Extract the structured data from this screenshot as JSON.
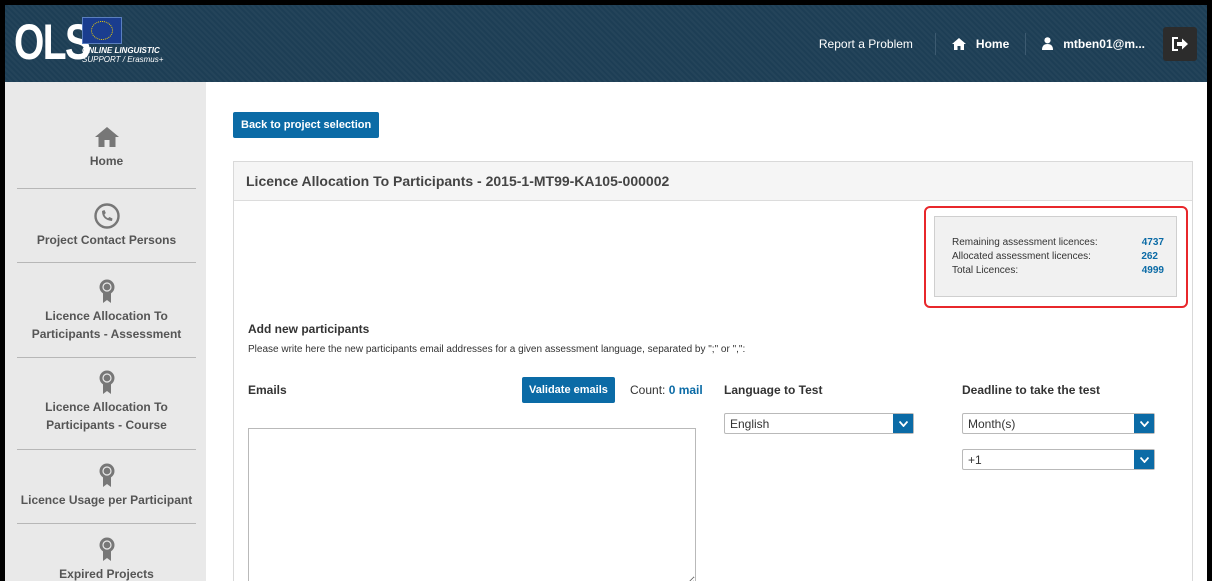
{
  "header": {
    "logo_text": "OLS",
    "logo_sub_line1": "ONLINE LINGUISTIC",
    "logo_sub_line2": "SUPPORT / Erasmus+",
    "report_problem": "Report a Problem",
    "home": "Home",
    "user": "mtben01@m...",
    "brand_color": "#1d3e55"
  },
  "sidebar": {
    "items": [
      {
        "label": "Home",
        "icon": "home-icon"
      },
      {
        "label": "Project Contact Persons",
        "icon": "phone-icon"
      },
      {
        "label": "Licence Allocation To Participants - Assessment",
        "icon": "award-icon"
      },
      {
        "label": "Licence Allocation To Participants - Course",
        "icon": "award-icon"
      },
      {
        "label": "Licence Usage per Participant",
        "icon": "award-icon"
      },
      {
        "label": "Expired Projects",
        "icon": "award-icon"
      }
    ]
  },
  "main": {
    "back_button": "Back to project selection",
    "panel_title": "Licence Allocation To Participants - 2015-1-MT99-KA105-000002",
    "stats": {
      "remaining_label": "Remaining assessment licences:",
      "remaining_value": "4737",
      "allocated_label": "Allocated assessment licences:",
      "allocated_value": "262",
      "total_label": "Total Licences:",
      "total_value": "4999"
    },
    "add_title": "Add new participants",
    "add_desc": "Please write here the new participants email addresses for a given assessment language, separated by \";\" or \",\":",
    "emails_label": "Emails",
    "emails_value": "",
    "validate_button": "Validate emails",
    "count_prefix": "Count:",
    "count_value": "0 mail",
    "language_label": "Language to Test",
    "language_selected": "English",
    "deadline_label": "Deadline to take the test",
    "deadline_unit_selected": "Month(s)",
    "deadline_amount_selected": "+1",
    "accent_color": "#0b6ba6",
    "highlight_color": "#e8272b"
  }
}
